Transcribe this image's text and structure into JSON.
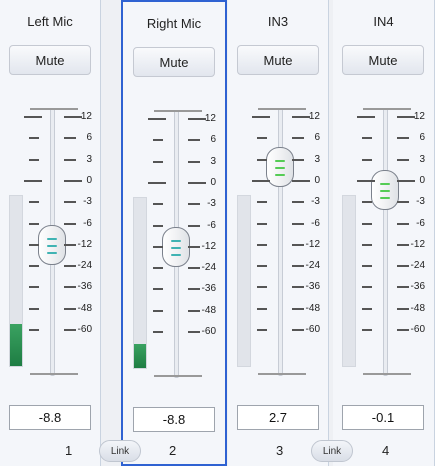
{
  "scale": [
    "12",
    "6",
    "3",
    "0",
    "-3",
    "-6",
    "-12",
    "-24",
    "-36",
    "-48",
    "-60"
  ],
  "channels": [
    {
      "name": "Left Mic",
      "mute": "Mute",
      "value": "-8.8",
      "number": "1",
      "meter_level": 0.25,
      "knob_color": "#3fb3b3",
      "selected": false
    },
    {
      "name": "Right Mic",
      "mute": "Mute",
      "value": "-8.8",
      "number": "2",
      "meter_level": 0.14,
      "knob_color": "#3fb3b3",
      "selected": true
    },
    {
      "name": "IN3",
      "mute": "Mute",
      "value": "2.7",
      "number": "3",
      "meter_level": 0,
      "knob_color": "#55cc55",
      "selected": false
    },
    {
      "name": "IN4",
      "mute": "Mute",
      "value": "-0.1",
      "number": "4",
      "meter_level": 0,
      "knob_color": "#55cc55",
      "selected": false
    }
  ],
  "links": [
    "Link",
    "Link"
  ]
}
